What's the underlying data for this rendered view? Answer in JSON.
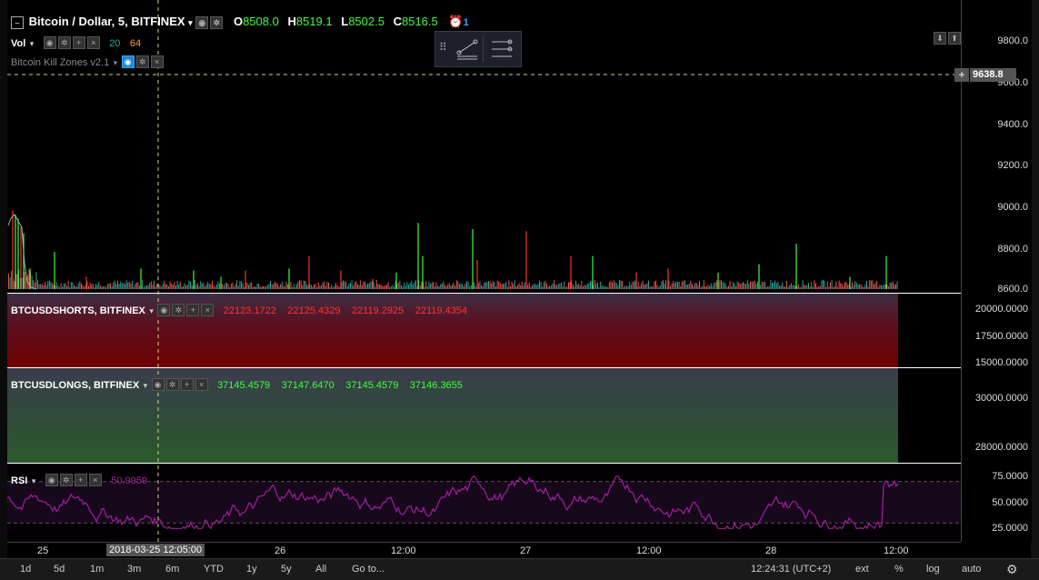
{
  "header": {
    "symbol": "Bitcoin / Dollar, 5, BITFINEX",
    "open_label": "O",
    "open": "8508.0",
    "high_label": "H",
    "high": "8519.1",
    "low_label": "L",
    "low": "8502.5",
    "close_label": "C",
    "close": "8516.5",
    "alerts_count": "1"
  },
  "indicators": {
    "vol_label": "Vol",
    "vol_a": "20",
    "vol_b": "64",
    "killzones_label": "Bitcoin Kill Zones v2.1"
  },
  "price_axis": {
    "ticks": [
      "9800.0",
      "9600.0",
      "9400.0",
      "9200.0",
      "9000.0",
      "8800.0",
      "8600.0"
    ],
    "crosshair_price": "9638.8"
  },
  "shorts": {
    "label": "BTCUSDSHORTS, BITFINEX",
    "values": [
      "22123.1722",
      "22125.4329",
      "22119.2925",
      "22119.4354"
    ],
    "ticks": [
      "20000.0000",
      "17500.0000",
      "15000.0000"
    ]
  },
  "longs": {
    "label": "BTCUSDLONGS, BITFINEX",
    "values": [
      "37145.4579",
      "37147.6470",
      "37145.4579",
      "37146.3655"
    ],
    "ticks": [
      "30000.0000",
      "28000.0000"
    ]
  },
  "rsi": {
    "label": "RSI",
    "value": "50.9959",
    "ticks": [
      "75.0000",
      "50.0000",
      "25.0000"
    ]
  },
  "time_axis": {
    "ticks": [
      "25",
      "26",
      "12:00",
      "27",
      "12:00",
      "28",
      "12:00"
    ],
    "crosshair_time": "2018-03-25 12:05:00"
  },
  "bottom_bar": {
    "ranges": [
      "1d",
      "5d",
      "1m",
      "3m",
      "6m",
      "YTD",
      "1y",
      "5y",
      "All"
    ],
    "goto": "Go to...",
    "clock": "12:24:31 (UTC+2)",
    "ext": "ext",
    "pct": "%",
    "log": "log",
    "auto": "auto"
  },
  "colors": {
    "up": "#26a69a",
    "down": "#ef5350",
    "bright_green": "#3dff3d",
    "bright_red": "#ff3030",
    "rsi": "#b000b0",
    "crosshair": "#d9d27a"
  }
}
